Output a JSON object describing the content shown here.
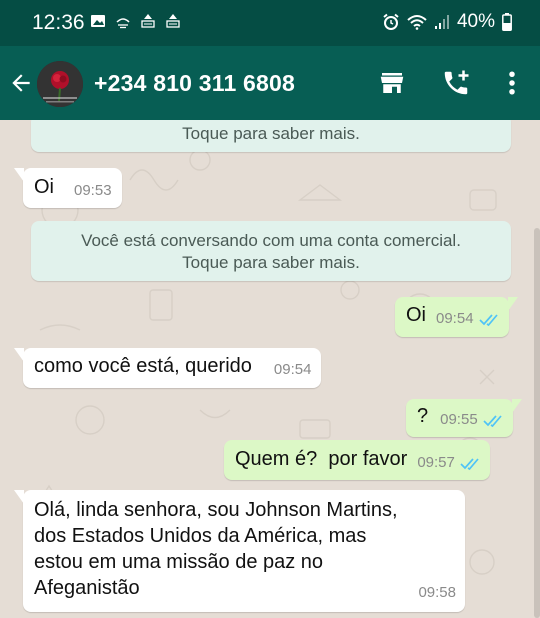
{
  "status_bar": {
    "time": "12:36",
    "battery": "40%",
    "icons": [
      "image-icon",
      "weather-icon",
      "sync-icon",
      "sync-icon",
      "alarm-icon",
      "wifi-icon",
      "signal-icon",
      "battery-icon"
    ]
  },
  "header": {
    "title": "+234 810 311 6808",
    "icons": [
      "back-arrow-icon",
      "store-icon",
      "add-call-icon",
      "more-vert-icon"
    ]
  },
  "chat": {
    "system_top": "Toque para saber mais.",
    "messages": [
      {
        "direction": "in",
        "text": "Oi",
        "time": "09:53"
      },
      {
        "direction": "system",
        "line1": "Você está conversando com uma conta comercial.",
        "line2": "Toque para saber mais."
      },
      {
        "direction": "out",
        "text": "Oi",
        "time": "09:54",
        "status": "read"
      },
      {
        "direction": "in",
        "text": "como você está, querido",
        "time": "09:54"
      },
      {
        "direction": "out",
        "text": "?",
        "time": "09:55",
        "status": "read"
      },
      {
        "direction": "out",
        "text": "Quem é?  por favor",
        "time": "09:57",
        "status": "read"
      },
      {
        "direction": "in",
        "lines": [
          "Olá, linda senhora, sou Johnson Martins,",
          "dos Estados Unidos da América, mas",
          "estou em uma missão de paz no",
          "Afeganistão"
        ],
        "time": "09:58"
      }
    ]
  },
  "colors": {
    "status_bar": "#054d44",
    "header": "#075e54",
    "chat_background": "#e5ddd5",
    "incoming_bubble": "#ffffff",
    "outgoing_bubble": "#dcf8c6",
    "system_bubble": "#e1f2ec",
    "read_ticks": "#4fc3f7"
  }
}
